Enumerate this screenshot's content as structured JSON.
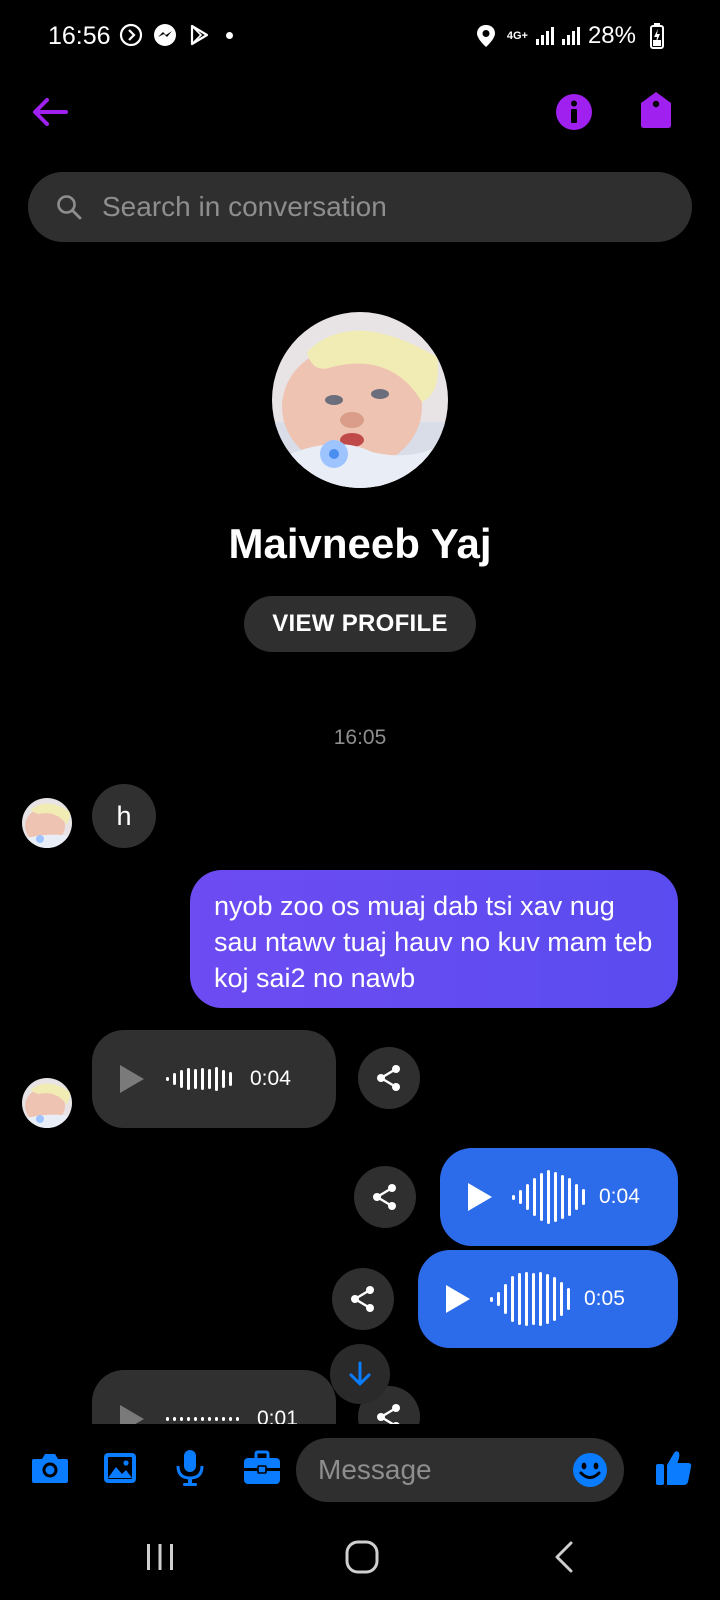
{
  "status_bar": {
    "time": "16:56",
    "network": "4G+",
    "battery": "28%"
  },
  "colors": {
    "accent_purple": "#a020f0",
    "messenger_blue": "#0a7cff",
    "outgoing_bubble": "#5a4cf0",
    "outgoing_audio": "#2c6bea"
  },
  "header": {
    "back_icon": "arrow-left-icon",
    "info_icon": "info-icon",
    "tag_icon": "tag-icon"
  },
  "search": {
    "placeholder": "Search in conversation"
  },
  "profile": {
    "name": "Maivneeb Yaj",
    "view_profile_label": "VIEW PROFILE"
  },
  "conversation": {
    "timestamp": "16:05",
    "messages": [
      {
        "direction": "in",
        "type": "text",
        "text": "h"
      },
      {
        "direction": "out",
        "type": "text",
        "text": "nyob zoo os muaj dab tsi xav nug sau ntawv tuaj hauv no kuv mam teb koj sai2 no nawb"
      },
      {
        "direction": "in",
        "type": "audio",
        "duration": "0:04"
      },
      {
        "direction": "out",
        "type": "audio",
        "duration": "0:04"
      },
      {
        "direction": "out",
        "type": "audio",
        "duration": "0:05"
      },
      {
        "direction": "in",
        "type": "audio",
        "duration": "0:01"
      }
    ]
  },
  "composer": {
    "placeholder": "Message"
  }
}
